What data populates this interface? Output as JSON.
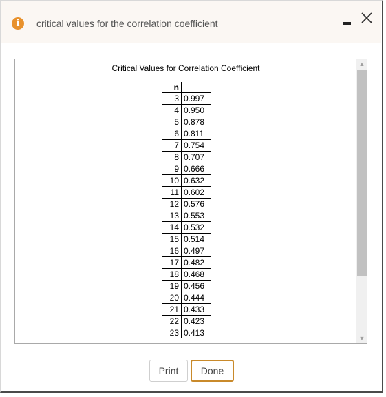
{
  "dialog": {
    "title": "critical values for the correlation coefficient",
    "info_icon": "i",
    "minimize_icon": "minimize-icon",
    "close_icon": "close-icon"
  },
  "table": {
    "title": "Critical Values for Correlation Coefficient",
    "header_n": "n",
    "header_value": "",
    "rows": [
      {
        "n": "3",
        "value": "0.997"
      },
      {
        "n": "4",
        "value": "0.950"
      },
      {
        "n": "5",
        "value": "0.878"
      },
      {
        "n": "6",
        "value": "0.811"
      },
      {
        "n": "7",
        "value": "0.754"
      },
      {
        "n": "8",
        "value": "0.707"
      },
      {
        "n": "9",
        "value": "0.666"
      },
      {
        "n": "10",
        "value": "0.632"
      },
      {
        "n": "11",
        "value": "0.602"
      },
      {
        "n": "12",
        "value": "0.576"
      },
      {
        "n": "13",
        "value": "0.553"
      },
      {
        "n": "14",
        "value": "0.532"
      },
      {
        "n": "15",
        "value": "0.514"
      },
      {
        "n": "16",
        "value": "0.497"
      },
      {
        "n": "17",
        "value": "0.482"
      },
      {
        "n": "18",
        "value": "0.468"
      },
      {
        "n": "19",
        "value": "0.456"
      },
      {
        "n": "20",
        "value": "0.444"
      },
      {
        "n": "21",
        "value": "0.433"
      },
      {
        "n": "22",
        "value": "0.423"
      },
      {
        "n": "23",
        "value": "0.413"
      }
    ]
  },
  "scrollbar": {
    "up_arrow": "▲",
    "down_arrow": "▼"
  },
  "buttons": {
    "print": "Print",
    "done": "Done"
  },
  "colors": {
    "accent": "#c98a2b",
    "info_icon": "#e8912c",
    "titlebar_bg": "#fbf7f3"
  }
}
